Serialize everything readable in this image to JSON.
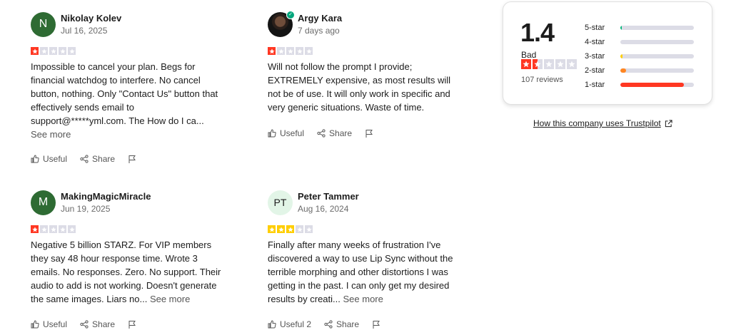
{
  "reviews": [
    {
      "avatar_text": "N",
      "name": "Nikolay Kolev",
      "date": "Jul 16, 2025",
      "rating": 1,
      "text": "Impossible to cancel your plan. Begs for financial watchdog to interfere. No cancel button, nothing. Only \"Contact Us\" button that effectively sends email to support@*****yml.com. The How do I ca...",
      "see_more": "See more",
      "useful": "Useful",
      "share": "Share"
    },
    {
      "avatar_text": "",
      "name": "Argy Kara",
      "date": "7 days ago",
      "rating": 1,
      "text": "Will not follow the prompt I provide; EXTREMELY expensive, as most results will not be of use. It will only work in specific and very generic situations. Waste of time.",
      "see_more": "",
      "useful": "Useful",
      "share": "Share"
    },
    {
      "avatar_text": "M",
      "name": "MakingMagicMiracle",
      "date": "Jun 19, 2025",
      "rating": 1,
      "text": "Negative 5 billion STARZ. For VIP members they say 48 hour response time. Wrote 3 emails. No responses. Zero. No support. Their audio to add is not working. Doesn't generate the same images. Liars no...",
      "see_more": "See more",
      "useful": "Useful",
      "share": "Share"
    },
    {
      "avatar_text": "PT",
      "name": "Peter Tammer",
      "date": "Aug 16, 2024",
      "rating": 3,
      "text": "Finally after many weeks of frustration I've discovered a way to use Lip Sync without the terrible morphing and other distortions I was getting in the past. I can only get my desired results by creati...",
      "see_more": "See more",
      "useful": "Useful 2",
      "share": "Share"
    }
  ],
  "summary": {
    "score": "1.4",
    "label": "Bad",
    "rating": 1.5,
    "count": "107 reviews",
    "bars": [
      {
        "label": "5-star",
        "fraction": 0.02,
        "color": "#00b67a"
      },
      {
        "label": "4-star",
        "fraction": 0.0,
        "color": "#73cf11"
      },
      {
        "label": "3-star",
        "fraction": 0.03,
        "color": "#ffce00"
      },
      {
        "label": "2-star",
        "fraction": 0.08,
        "color": "#ff8622"
      },
      {
        "label": "1-star",
        "fraction": 0.86,
        "color": "#ff3722"
      }
    ]
  },
  "how_link": "How this company uses Trustpilot",
  "colors": {
    "star_red": "#ff3722",
    "star_yellow": "#ffce00",
    "star_empty": "#dcdce6"
  }
}
